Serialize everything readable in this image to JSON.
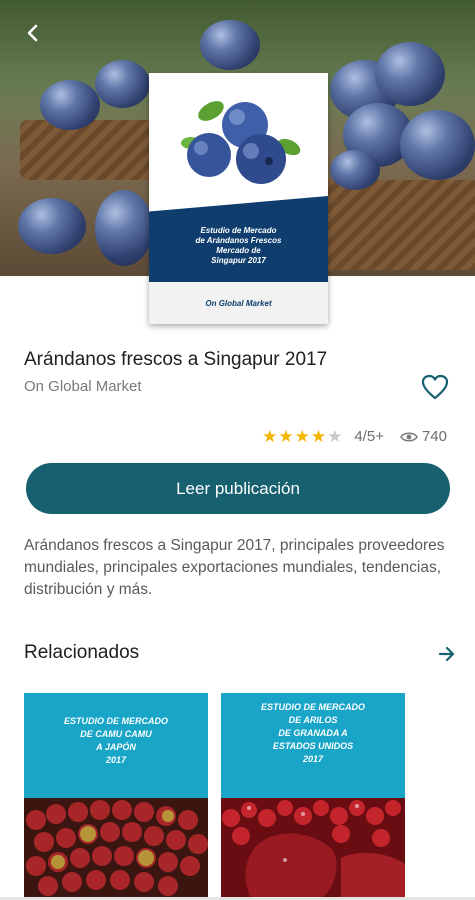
{
  "book": {
    "title": "Arándanos frescos a Singapur 2017",
    "publisher": "On Global Market",
    "rating": 4,
    "rating_max": 5,
    "rating_text": "4/5+",
    "views": "740",
    "cover_title": "Estudio de Mercado\nde Arándanos Frescos\nMercado de\nSingapur 2017",
    "cover_publisher": "On Global Market",
    "read_button": "Leer publicación",
    "description": "Arándanos frescos a Singapur 2017, principales proveedores mundiales, principales exportaciones mundiales, tendencias, distribución y más."
  },
  "related": {
    "heading": "Relacionados",
    "items": [
      {
        "cover_text": "ESTUDIO DE MERCADO\nDE CAMU CAMU\nA JAPÓN\n2017"
      },
      {
        "cover_text": "ESTUDIO DE MERCADO\nDE ARILOS\nDE GRANADA A\nESTADOS UNIDOS\n2017"
      }
    ]
  },
  "icons": {
    "back": "arrow-back-icon",
    "favorite": "heart-outline-icon",
    "views": "eye-icon",
    "related_more": "arrow-forward-icon"
  },
  "colors": {
    "primary": "#17606f",
    "accent": "#17606f",
    "star": "#f4b400",
    "cover_band": "#0f3e6e",
    "related_card": "#18a5c8"
  }
}
